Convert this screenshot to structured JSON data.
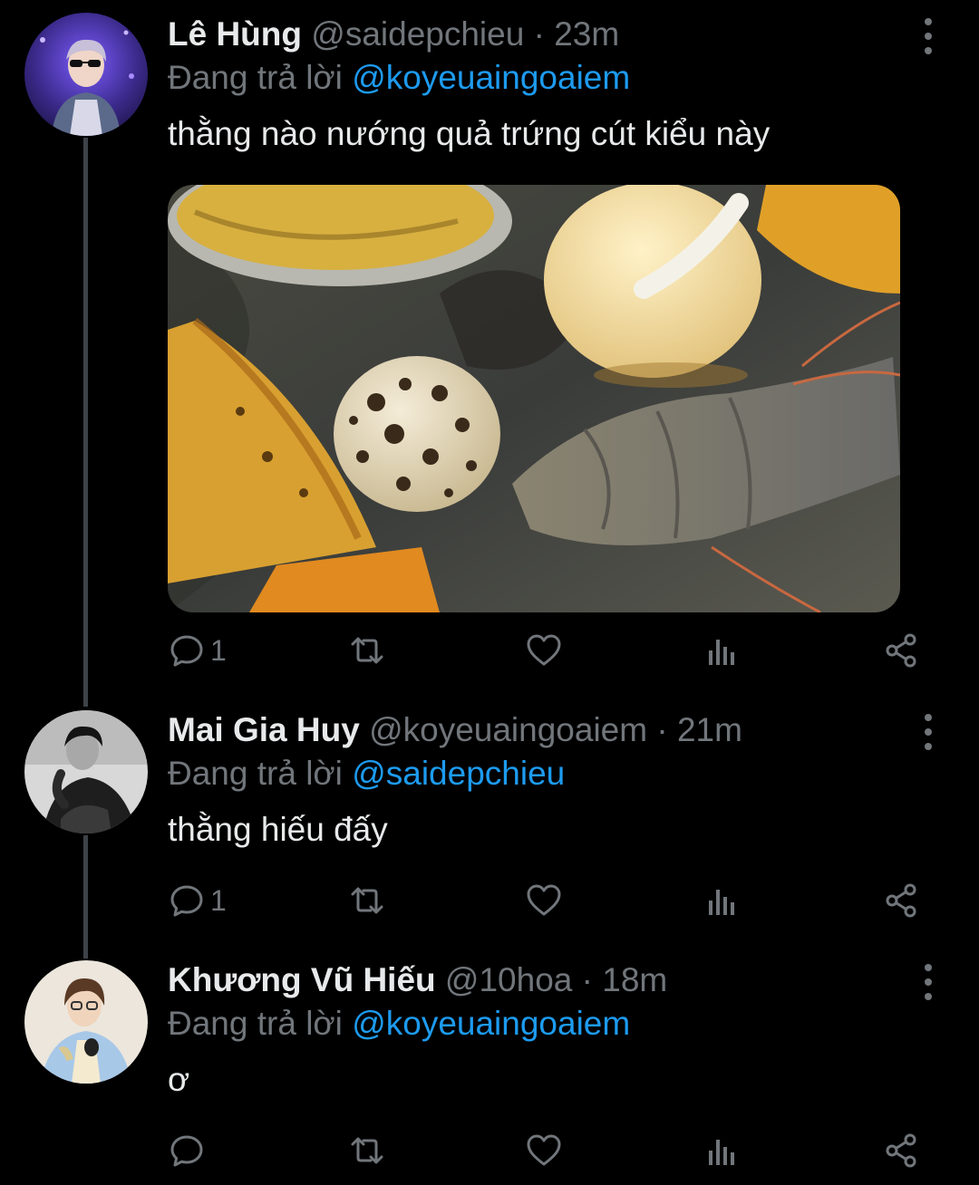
{
  "tweets": [
    {
      "display_name": "Lê Hùng",
      "handle": "@saidepchieu",
      "separator": "·",
      "time": "23m",
      "reply_prefix": "Đang trả lời",
      "reply_handle": "@koyeuaingoaiem",
      "text": "thằng nào nướng quả trứng cút kiểu này",
      "reply_count": "1",
      "media": "photo of grilled quail egg, shrimp, fish ball and tofu on a foil tray"
    },
    {
      "display_name": "Mai Gia Huy",
      "handle": "@koyeuaingoaiem",
      "separator": "·",
      "time": "21m",
      "reply_prefix": "Đang trả lời",
      "reply_handle": "@saidepchieu",
      "text": "thằng hiếu đấy",
      "reply_count": "1"
    },
    {
      "display_name": "Khương Vũ Hiếu",
      "handle": "@10hoa",
      "separator": "·",
      "time": "18m",
      "reply_prefix": "Đang trả lời",
      "reply_handle": "@koyeuaingoaiem",
      "text": "ơ",
      "reply_count": ""
    }
  ],
  "icons": {
    "reply": "reply-icon",
    "retweet": "retweet-icon",
    "like": "heart-icon",
    "analytics": "analytics-icon",
    "share": "share-icon",
    "more": "more-vertical-icon"
  },
  "colors": {
    "background": "#000000",
    "primary_text": "#e7e9ea",
    "secondary_text": "#71767b",
    "link": "#1d9bf0",
    "thread_line": "#3d4248"
  }
}
